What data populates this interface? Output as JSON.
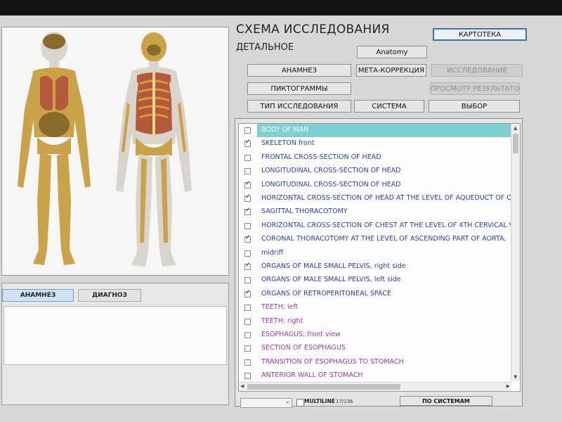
{
  "header": {
    "title": "СХЕМА ИССЛЕДОВАНИЯ",
    "subtitle": "ДЕТАЛЬНОЕ"
  },
  "buttons": {
    "kartoteka": "КАРТОТЕКА",
    "anatomy": "Anatomy",
    "anamnez": "АНАМНЕЗ",
    "meta_correction": "МЕТА-КОРРЕКЦИЯ",
    "issledovanie": "ИССЛЕДОВАНИЕ",
    "piktogrammy": "ПИКТОГРАММЫ",
    "prosmotr": "ПРОСМОТР РЕЗУЛЬТАТОВ",
    "tip_issledovaniya": "ТИП ИССЛЕДОВАНИЯ",
    "sistema": "СИСТЕМА",
    "vybor": "ВЫБОР",
    "po_sistemam": "ПО СИСТЕМАМ"
  },
  "lower_tabs": [
    {
      "label": "АНАМНЕЗ",
      "active": true
    },
    {
      "label": "ДИАГНОЗ",
      "active": false
    }
  ],
  "list": {
    "items": [
      {
        "label": "BODY OF MAN",
        "checked": false,
        "color": "#ffffff",
        "selected": true
      },
      {
        "label": "SKELETON front",
        "checked": true,
        "color": "#2a3fb8",
        "selected": false
      },
      {
        "label": "FRONTAL CROSS-SECTION OF HEAD",
        "checked": false,
        "color": "#2a3fb8",
        "selected": false
      },
      {
        "label": "LONGITUDINAL CROSS-SECTION OF HEAD",
        "checked": false,
        "color": "#2a3fb8",
        "selected": false
      },
      {
        "label": "LONGITUDINAL CROSS-SECTION OF HEAD",
        "checked": true,
        "color": "#2a3fb8",
        "selected": false
      },
      {
        "label": "HORIZONTAL CROSS-SECTION OF HEAD AT THE LEVEL OF AQUEDUCT OF C",
        "checked": true,
        "color": "#2a3fb8",
        "selected": false
      },
      {
        "label": "SAGITTAL THORACOTOMY",
        "checked": true,
        "color": "#2a3fb8",
        "selected": false
      },
      {
        "label": "HORIZONTAL CROSS-SECTION OF CHEST AT THE LEVEL OF 4TH CERVICAL V",
        "checked": false,
        "color": "#2a3fb8",
        "selected": false
      },
      {
        "label": "CORONAL THORACOTOMY AT THE LEVEL OF ASCENDING PART OF AORTA,",
        "checked": true,
        "color": "#2a3fb8",
        "selected": false
      },
      {
        "label": "midriff",
        "checked": false,
        "color": "#2a3fb8",
        "selected": false
      },
      {
        "label": "ORGANS OF MALE SMALL PELVIS, right side",
        "checked": true,
        "color": "#2a3fb8",
        "selected": false
      },
      {
        "label": "ORGANS OF MALE SMALL PELVIS, left side",
        "checked": false,
        "color": "#2a3fb8",
        "selected": false
      },
      {
        "label": "ORGANS OF RETROPERITONEAL SPACE",
        "checked": true,
        "color": "#2a3fb8",
        "selected": false
      },
      {
        "label": "TEETH; left",
        "checked": false,
        "color": "#a23aa6",
        "selected": false
      },
      {
        "label": "TEETH; right",
        "checked": false,
        "color": "#a23aa6",
        "selected": false
      },
      {
        "label": "ESOPHAGUS; front view",
        "checked": false,
        "color": "#a23aa6",
        "selected": false
      },
      {
        "label": "SECTION OF ESOPHAGUS",
        "checked": false,
        "color": "#a23aa6",
        "selected": false
      },
      {
        "label": "TRANSITION OF ESOPHAGUS TO STOMACH",
        "checked": false,
        "color": "#a23aa6",
        "selected": false
      },
      {
        "label": "ANTERIOR  WALL  OF  STOMACH",
        "checked": false,
        "color": "#a23aa6",
        "selected": false
      }
    ]
  },
  "footer": {
    "multiline_label": "MULTILINE",
    "count": "17/236"
  },
  "colors": {
    "selection": "#7fd0d2",
    "primary_border": "#3a72b8",
    "item_blue": "#2a3fb8",
    "item_purple": "#a23aa6"
  }
}
